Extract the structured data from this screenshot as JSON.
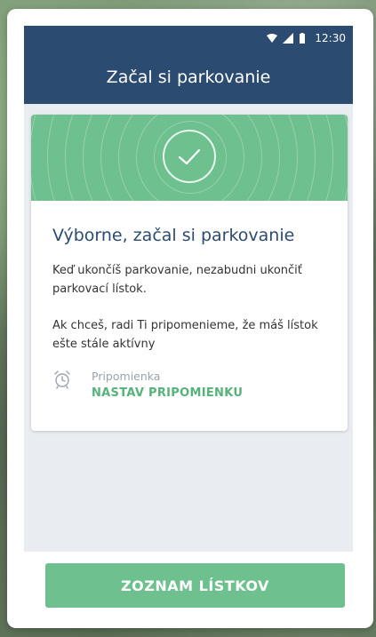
{
  "status_bar": {
    "time": "12:30"
  },
  "app_bar": {
    "title": "Začal si parkovanie"
  },
  "card": {
    "headline": "Výborne, začal si parkovanie",
    "paragraph_1": "Keď ukončíš parkovanie, nezabudni ukončiť parkovací lístok.",
    "paragraph_2": "Ak chceš, radi Ti pripomenieme, že máš lístok ešte stále aktívny",
    "reminder_label": "Pripomienka",
    "reminder_action": "NASTAV PRIPOMIENKU"
  },
  "bottom_button": {
    "label": "ZOZNAM LÍSTKOV"
  },
  "colors": {
    "primary_dark": "#2c4b70",
    "accent_green": "#6ec08f"
  },
  "icons": {
    "success": "checkmark-circle-icon",
    "reminder": "alarm-clock-icon",
    "status": [
      "wifi-icon",
      "signal-icon",
      "battery-icon"
    ]
  }
}
